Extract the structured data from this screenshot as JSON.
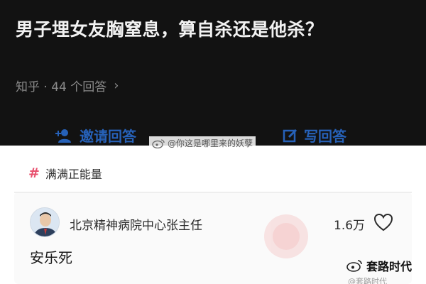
{
  "question": {
    "title": "男子埋女友胸窒息，算自杀还是他杀？",
    "meta": "知乎 · 44 个回答"
  },
  "actions": {
    "invite_label": "邀请回答",
    "write_label": "写回答"
  },
  "watermark_top": {
    "text": "@你这是哪里来的妖孽"
  },
  "topic": {
    "label": "满满正能量"
  },
  "answer": {
    "author": "北京精神病院中心张主任",
    "count": "1.6万",
    "text": "安乐死"
  },
  "watermark_bottom": {
    "brand": "套路时代",
    "sub": "@套路时代"
  },
  "colors": {
    "dark_bg": "#121212",
    "accent_blue": "#2a6fd6",
    "hash_pink": "#e8506e"
  },
  "icons": [
    "chevron-right-icon",
    "add-user-icon",
    "pencil-icon",
    "weibo-icon",
    "hash-icon",
    "heart-icon",
    "avatar-photo"
  ]
}
